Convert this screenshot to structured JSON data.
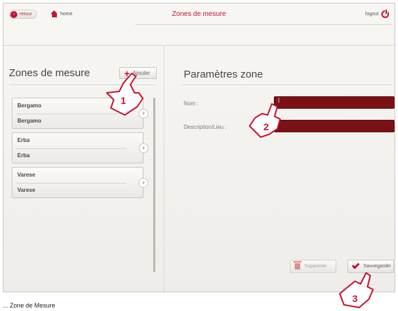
{
  "header": {
    "back_label": "retour",
    "home_label": "home",
    "title": "Zones de mesure",
    "logout_label": "logout"
  },
  "left": {
    "title": "Zones de mesure",
    "add_label": "Ajouter",
    "zones": [
      {
        "name": "Bergamo",
        "description": "Bergamo"
      },
      {
        "name": "Erba",
        "description": "Erba"
      },
      {
        "name": "Varese",
        "description": "Varese"
      }
    ]
  },
  "right": {
    "title": "Paramètres zone",
    "name_label": "Nom :",
    "name_value": "|",
    "description_label": "Description/Lieu :",
    "description_value": "",
    "delete_label": "Supprimer",
    "save_label": "Sauvegarder"
  },
  "callouts": [
    "1",
    "2",
    "3"
  ],
  "footer": {
    "text": "... Zone de Mesure"
  },
  "colors": {
    "accent": "#c8102e",
    "input_bg": "#7a1116"
  }
}
